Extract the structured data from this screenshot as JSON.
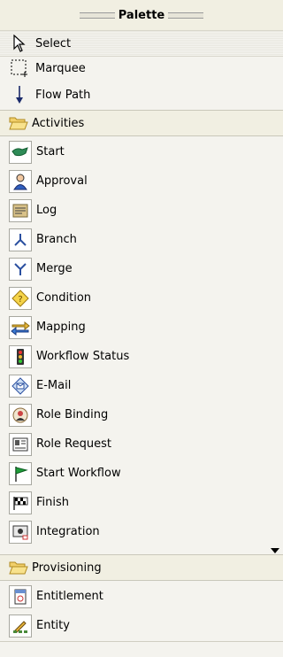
{
  "palette": {
    "title": "Palette",
    "tools": [
      {
        "label": "Select",
        "icon": "arrow-cursor-icon"
      },
      {
        "label": "Marquee",
        "icon": "marquee-icon"
      },
      {
        "label": "Flow Path",
        "icon": "down-arrow-icon"
      }
    ],
    "drawers": [
      {
        "label": "Activities",
        "items": [
          {
            "label": "Start",
            "icon": "start-icon"
          },
          {
            "label": "Approval",
            "icon": "approval-person-icon"
          },
          {
            "label": "Log",
            "icon": "log-icon"
          },
          {
            "label": "Branch",
            "icon": "branch-icon"
          },
          {
            "label": "Merge",
            "icon": "merge-icon"
          },
          {
            "label": "Condition",
            "icon": "condition-diamond-icon"
          },
          {
            "label": "Mapping",
            "icon": "mapping-arrows-icon"
          },
          {
            "label": "Workflow Status",
            "icon": "traffic-light-icon"
          },
          {
            "label": "E-Mail",
            "icon": "email-icon"
          },
          {
            "label": "Role Binding",
            "icon": "role-binding-icon"
          },
          {
            "label": "Role Request",
            "icon": "role-request-icon"
          },
          {
            "label": "Start Workflow",
            "icon": "green-flag-icon"
          },
          {
            "label": "Finish",
            "icon": "checkered-flag-icon"
          },
          {
            "label": "Integration",
            "icon": "integration-icon"
          }
        ]
      },
      {
        "label": "Provisioning",
        "items": [
          {
            "label": "Entitlement",
            "icon": "entitlement-icon"
          },
          {
            "label": "Entity",
            "icon": "entity-icon"
          }
        ]
      }
    ]
  }
}
